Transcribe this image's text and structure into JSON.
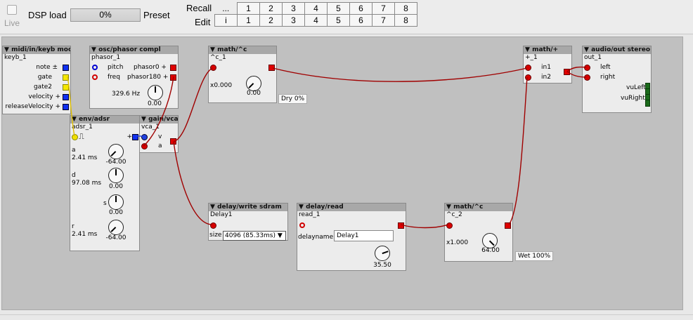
{
  "toolbar": {
    "live_label": "Live",
    "dsp_label": "DSP load",
    "dsp_value": "0%",
    "dsp_fraction": 0.0,
    "preset_label": "Preset",
    "recall_label": "Recall",
    "edit_label": "Edit",
    "recall_extra": "...",
    "edit_extra": "i",
    "slots": [
      "1",
      "2",
      "3",
      "4",
      "5",
      "6",
      "7",
      "8"
    ]
  },
  "objects": {
    "keyb": {
      "type": "midi/in/keyb mod",
      "name": "keyb_1",
      "outlets": [
        "note",
        "gate",
        "gate2",
        "velocity",
        "releaseVelocity"
      ],
      "outlet_signs": [
        "±",
        "",
        "",
        "+",
        "+"
      ]
    },
    "osc": {
      "type": "osc/phasor compl",
      "name": "phasor_1",
      "inlets": [
        "pitch",
        "freq"
      ],
      "outlets": [
        "phasor0",
        "phasor180"
      ],
      "freq_readout": "329.6 Hz",
      "knob_value": "0.00"
    },
    "env": {
      "type": "env/adsr",
      "name": "adsr_1",
      "a_label": "a",
      "a_value": "2.41 ms",
      "a_knob": "-64.00",
      "d_label": "d",
      "d_value": "97.08 ms",
      "d_knob": "0.00",
      "s_label": "s",
      "s_knob": "0.00",
      "r_label": "r",
      "r_value": "2.41 ms",
      "r_knob": "-64.00",
      "out_sign": "+"
    },
    "vca": {
      "type": "gain/vca",
      "name": "vca_1",
      "inlets": [
        "v",
        "a"
      ]
    },
    "c1": {
      "type": "math/^c",
      "name": "^c_1",
      "mult": "x0.000",
      "knob_value": "0.00",
      "label": "Dry 0%"
    },
    "plus": {
      "type": "math/+",
      "name": "+_1",
      "inlets": [
        "in1",
        "in2"
      ]
    },
    "out": {
      "type": "audio/out stereo",
      "name": "out_1",
      "inlets": [
        "left",
        "right"
      ],
      "meters": [
        "vuLeft",
        "vuRight"
      ]
    },
    "dwrite": {
      "type": "delay/write sdram",
      "name": "Delay1",
      "size_label": "size",
      "size_value": "4096 (85.33ms) ▼"
    },
    "dread": {
      "type": "delay/read",
      "name": "read_1",
      "delayname_label": "delayname",
      "delayname_value": "Delay1",
      "knob_value": "35.50"
    },
    "c2": {
      "type": "math/^c",
      "name": "^c_2",
      "mult": "x1.000",
      "knob_value": "64.00",
      "label": "Wet 100%"
    }
  },
  "colors": {
    "canvas": "#c0c0c0",
    "header": "#a8a8a8",
    "wire": "#a00000"
  }
}
